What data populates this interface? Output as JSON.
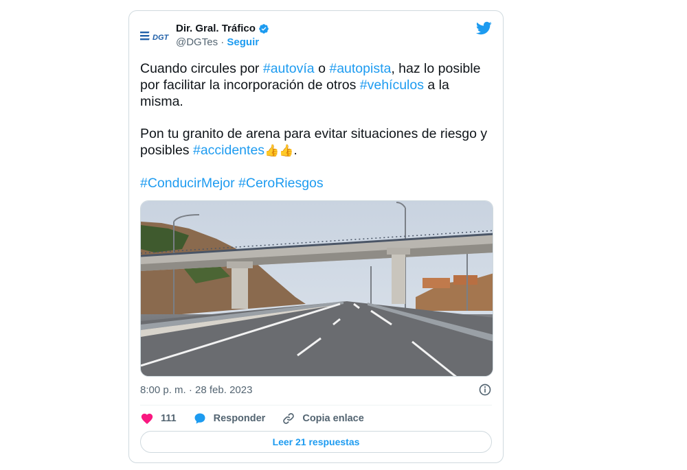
{
  "author": {
    "name": "Dir. Gral. Tráfico",
    "handle": "@DGTes",
    "separator": " · ",
    "follow_label": "Seguir",
    "logo_text": "DGT"
  },
  "tweet": {
    "p1": [
      {
        "t": "Cuando circules por "
      },
      {
        "t": "#autovía",
        "tag": true
      },
      {
        "t": " o "
      },
      {
        "t": "#autopista",
        "tag": true
      },
      {
        "t": ", haz lo posible por facilitar la incorporación de otros "
      },
      {
        "t": "#vehículos",
        "tag": true
      },
      {
        "t": " a la misma."
      }
    ],
    "p2": [
      {
        "t": "Pon tu granito de arena para evitar situaciones de riesgo y posibles "
      },
      {
        "t": "#accidentes",
        "tag": true
      },
      {
        "t": "👍👍",
        "emoji": true
      },
      {
        "t": "."
      }
    ],
    "p3": [
      {
        "t": "#ConducirMejor",
        "tag": true
      },
      {
        "t": " "
      },
      {
        "t": "#CeroRiesgos",
        "tag": true
      }
    ]
  },
  "timestamp": "8:00 p. m. · 28 feb. 2023",
  "actions": {
    "likes": "111",
    "reply_label": "Responder",
    "copy_label": "Copia enlace"
  },
  "read_replies_label": "Leer 21 respuestas",
  "colors": {
    "link": "#1d9bf0",
    "like": "#f91880",
    "text": "#0f1419",
    "muted": "#536471"
  }
}
